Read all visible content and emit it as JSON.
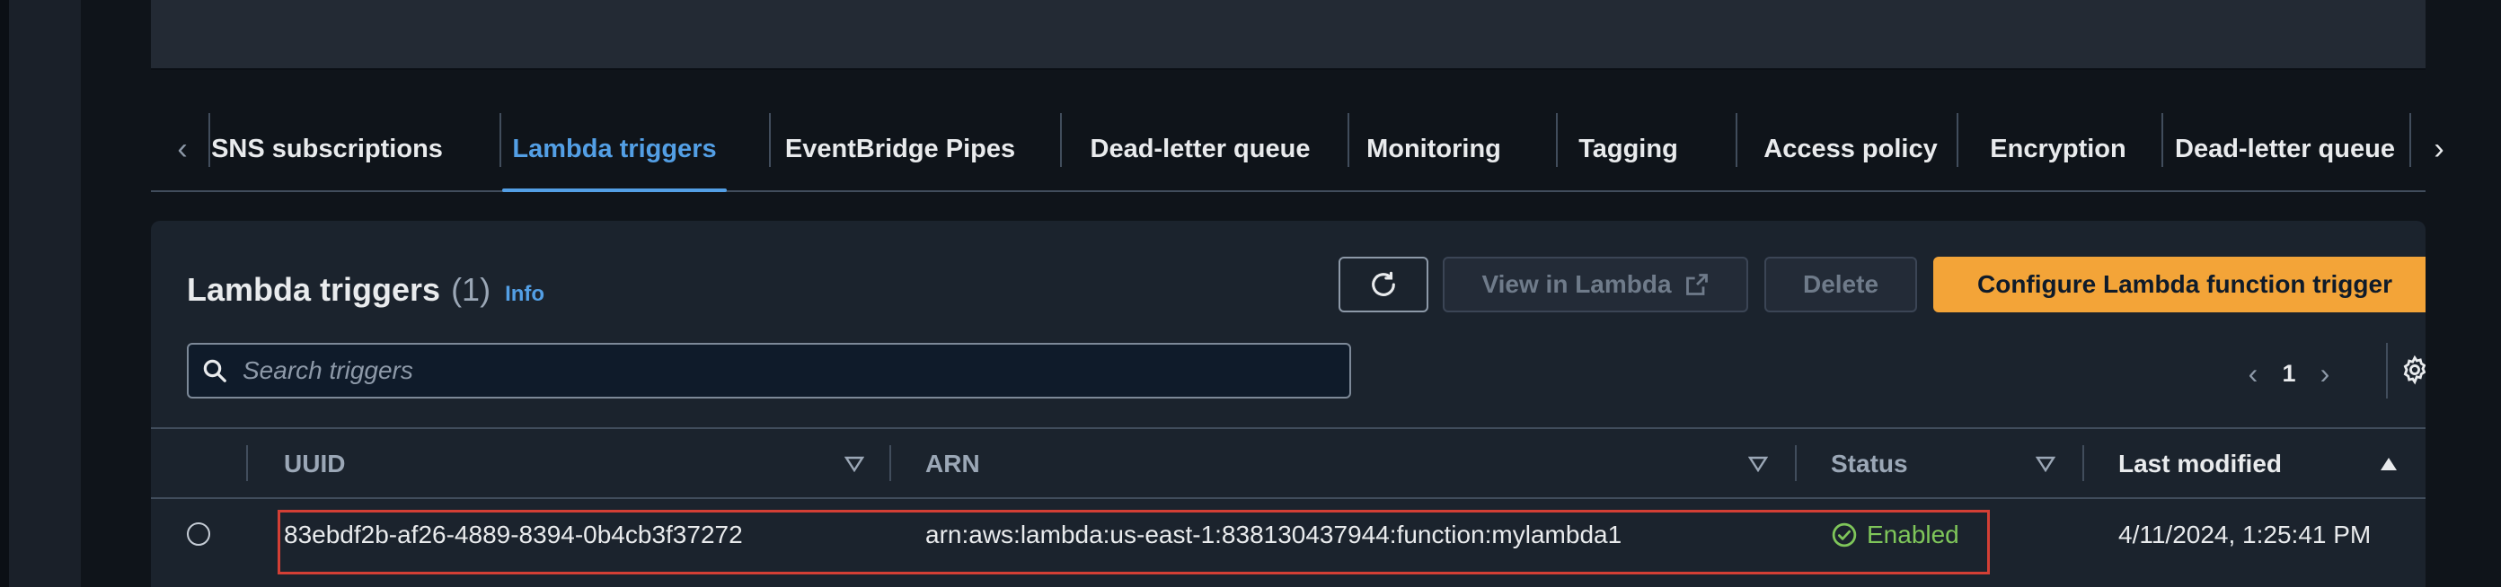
{
  "tabs": {
    "items": [
      {
        "label": "SNS subscriptions",
        "active": false
      },
      {
        "label": "Lambda triggers",
        "active": true
      },
      {
        "label": "EventBridge Pipes",
        "active": false
      },
      {
        "label": "Dead-letter queue",
        "active": false
      },
      {
        "label": "Monitoring",
        "active": false
      },
      {
        "label": "Tagging",
        "active": false
      },
      {
        "label": "Access policy",
        "active": false
      },
      {
        "label": "Encryption",
        "active": false
      },
      {
        "label": "Dead-letter queue",
        "active": false
      }
    ]
  },
  "panel": {
    "title": "Lambda triggers",
    "count": "(1)",
    "info_link": "Info",
    "buttons": {
      "view_in_lambda": "View in Lambda",
      "delete": "Delete",
      "configure": "Configure Lambda function trigger"
    },
    "search": {
      "placeholder": "Search triggers",
      "value": ""
    },
    "pagination": {
      "current_page": "1"
    }
  },
  "table": {
    "columns": [
      "UUID",
      "ARN",
      "Status",
      "Last modified"
    ],
    "sorted_column": "Last modified",
    "sort_direction": "ascending",
    "rows": [
      {
        "uuid": "83ebdf2b-af26-4889-8394-0b4cb3f37272",
        "arn": "arn:aws:lambda:us-east-1:838130437944:function:mylambda1",
        "status": "Enabled",
        "last_modified": "4/11/2024, 1:25:41 PM"
      }
    ]
  },
  "colors": {
    "accent_link": "#539fe5",
    "primary_button": "#f3a438",
    "status_enabled": "#7fc65a",
    "highlight_border": "#d33f35"
  },
  "icons": {
    "refresh": "refresh-icon",
    "external_link": "external-link-icon",
    "search": "search-icon",
    "settings": "gear-icon",
    "status": "check-circle-icon",
    "filter": "caret-down-icon",
    "sort": "sort-ascending-icon"
  }
}
